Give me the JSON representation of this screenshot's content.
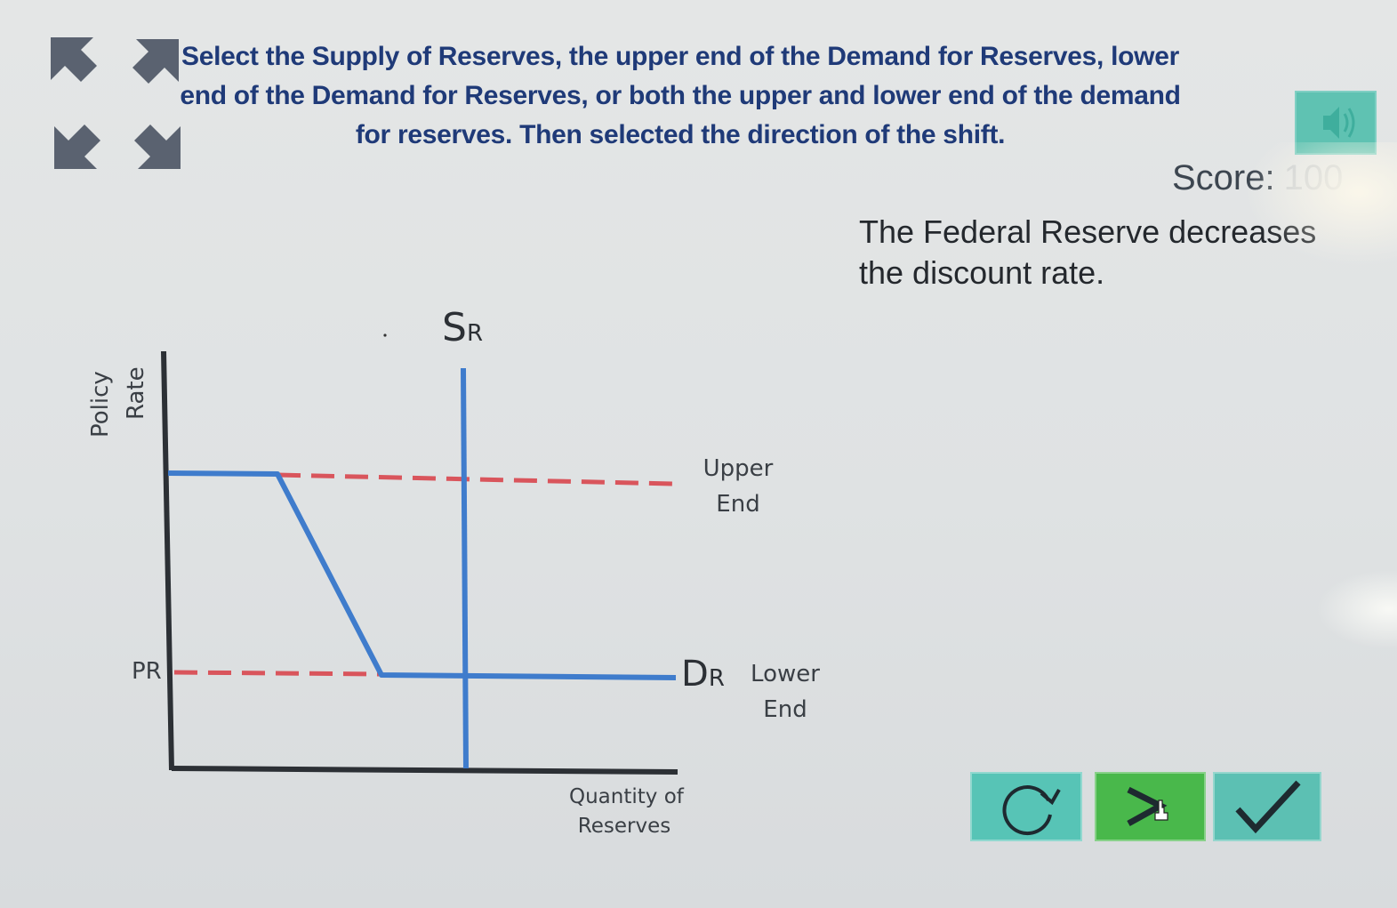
{
  "instruction": "Select the Supply of Reserves, the upper end of the Demand for Reserves, lower end of the Demand for Reserves, or both the upper and lower end of the demand for reserves. Then selected the direction of the shift.",
  "score": {
    "label": "Score:",
    "value": "100"
  },
  "scenario": "The Federal Reserve decreases the discount rate.",
  "graph": {
    "supply_label": {
      "main": "S",
      "sub": "R"
    },
    "demand_label": {
      "main": "D",
      "sub": "R"
    },
    "ylabel_line1": "Policy",
    "ylabel_line2": "Rate",
    "upper_end_line1": "Upper",
    "upper_end_line2": "End",
    "lower_end_line1": "Lower",
    "lower_end_line2": "End",
    "pr_label": "PR",
    "xlabel_line1": "Quantity of",
    "xlabel_line2": "Reserves"
  },
  "buttons": [
    "reset-icon",
    "next-icon",
    "checkmark-icon"
  ],
  "colors": {
    "instruction_text": "#1f3a78",
    "curve_blue": "#3f7ccc",
    "dashed_red": "#d9555c",
    "axis": "#2c3035",
    "teal_button": "#57c4b6",
    "green_button": "#49b84b"
  }
}
